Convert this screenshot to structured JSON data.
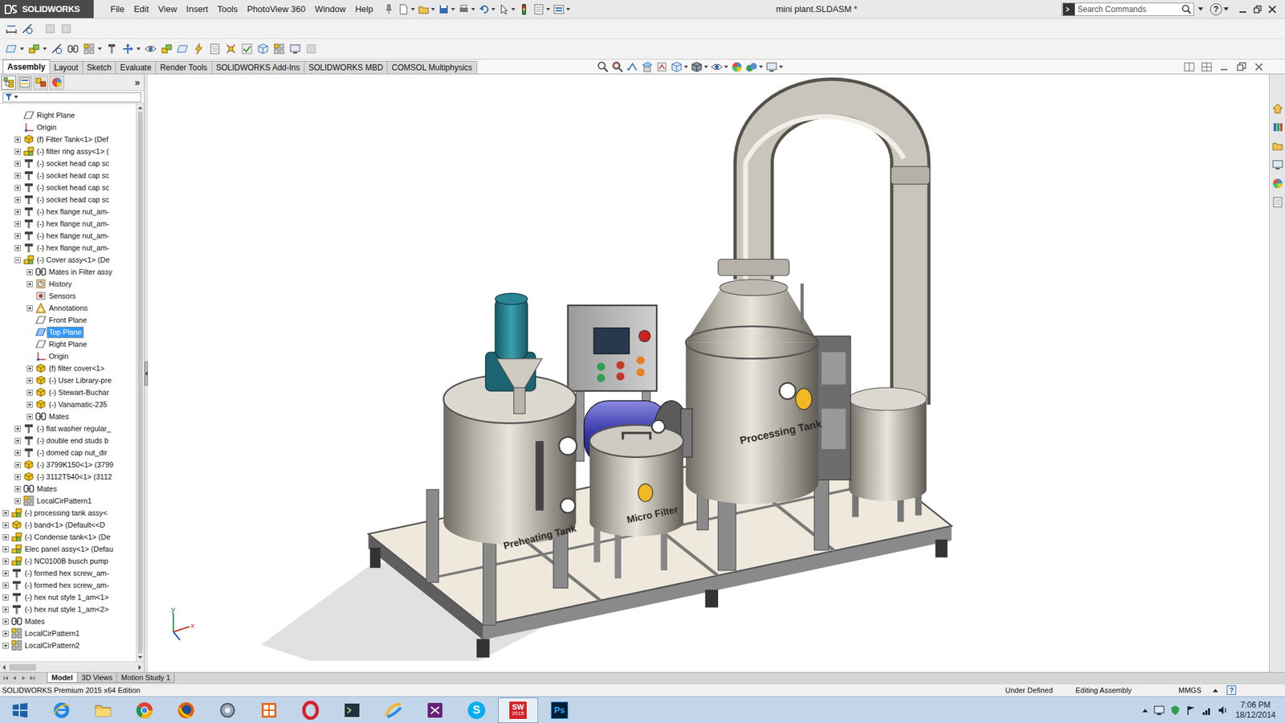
{
  "window": {
    "title": "mini plant.SLDASM *",
    "logo": "SOLIDWORKS",
    "help": "?"
  },
  "menu": [
    "File",
    "Edit",
    "View",
    "Insert",
    "Tools",
    "PhotoView 360",
    "Window",
    "Help"
  ],
  "search": {
    "placeholder": "Search Commands"
  },
  "command_tabs": [
    {
      "label": "Assembly",
      "selected": true
    },
    {
      "label": "Layout",
      "selected": false
    },
    {
      "label": "Sketch",
      "selected": false
    },
    {
      "label": "Evaluate",
      "selected": false
    },
    {
      "label": "Render Tools",
      "selected": false
    },
    {
      "label": "SOLIDWORKS Add-Ins",
      "selected": false
    },
    {
      "label": "SOLIDWORKS MBD",
      "selected": false
    },
    {
      "label": "COMSOL Multiphysics",
      "selected": false
    }
  ],
  "left_panel": {
    "tabs": [
      {
        "kind": "feature",
        "selected": true
      },
      {
        "kind": "property",
        "selected": false
      },
      {
        "kind": "configuration",
        "selected": false
      },
      {
        "kind": "display",
        "selected": false
      }
    ],
    "more": "»"
  },
  "feature_tree": {
    "items": [
      {
        "label": "Right Plane",
        "level": 1,
        "kind": "plane",
        "expandable": false,
        "expanded": false,
        "selected": false
      },
      {
        "label": "Origin",
        "level": 1,
        "kind": "origin",
        "expandable": false,
        "expanded": false,
        "selected": false
      },
      {
        "label": "(f) Filter Tank<1> (Def",
        "level": 1,
        "kind": "part",
        "expandable": true,
        "expanded": false,
        "selected": false
      },
      {
        "label": "(-) filter ring assy<1> (",
        "level": 1,
        "kind": "assembly",
        "expandable": true,
        "expanded": false,
        "selected": false
      },
      {
        "label": "(-) socket head cap sc",
        "level": 1,
        "kind": "hardware",
        "expandable": true,
        "expanded": false,
        "selected": false
      },
      {
        "label": "(-) socket head cap sc",
        "level": 1,
        "kind": "hardware",
        "expandable": true,
        "expanded": false,
        "selected": false
      },
      {
        "label": "(-) socket head cap sc",
        "level": 1,
        "kind": "hardware",
        "expandable": true,
        "expanded": false,
        "selected": false
      },
      {
        "label": "(-) socket head cap sc",
        "level": 1,
        "kind": "hardware",
        "expandable": true,
        "expanded": false,
        "selected": false
      },
      {
        "label": "(-) hex flange nut_am-",
        "level": 1,
        "kind": "hardware",
        "expandable": true,
        "expanded": false,
        "selected": false
      },
      {
        "label": "(-) hex flange nut_am-",
        "level": 1,
        "kind": "hardware",
        "expandable": true,
        "expanded": false,
        "selected": false
      },
      {
        "label": "(-) hex flange nut_am-",
        "level": 1,
        "kind": "hardware",
        "expandable": true,
        "expanded": false,
        "selected": false
      },
      {
        "label": "(-) hex flange nut_am-",
        "level": 1,
        "kind": "hardware",
        "expandable": true,
        "expanded": false,
        "selected": false
      },
      {
        "label": "(-) Cover assy<1> (De",
        "level": 1,
        "kind": "assembly",
        "expandable": true,
        "expanded": true,
        "selected": false
      },
      {
        "label": "Mates in Filter assy",
        "level": 2,
        "kind": "mates",
        "expandable": true,
        "expanded": false,
        "selected": false
      },
      {
        "label": "History",
        "level": 2,
        "kind": "history",
        "expandable": true,
        "expanded": false,
        "selected": false
      },
      {
        "label": "Sensors",
        "level": 2,
        "kind": "sensors",
        "expandable": false,
        "expanded": false,
        "selected": false
      },
      {
        "label": "Annotations",
        "level": 2,
        "kind": "annotations",
        "expandable": true,
        "expanded": false,
        "selected": false
      },
      {
        "label": "Front Plane",
        "level": 2,
        "kind": "plane",
        "expandable": false,
        "expanded": false,
        "selected": false
      },
      {
        "label": "Top Plane",
        "level": 2,
        "kind": "plane",
        "expandable": false,
        "expanded": false,
        "selected": true
      },
      {
        "label": "Right Plane",
        "level": 2,
        "kind": "plane",
        "expandable": false,
        "expanded": false,
        "selected": false
      },
      {
        "label": "Origin",
        "level": 2,
        "kind": "origin",
        "expandable": false,
        "expanded": false,
        "selected": false
      },
      {
        "label": "(f) filter cover<1>",
        "level": 2,
        "kind": "part",
        "expandable": true,
        "expanded": false,
        "selected": false
      },
      {
        "label": "(-) User Library-pre",
        "level": 2,
        "kind": "part",
        "expandable": true,
        "expanded": false,
        "selected": false
      },
      {
        "label": "(-) Stewart-Buchar",
        "level": 2,
        "kind": "part",
        "expandable": true,
        "expanded": false,
        "selected": false
      },
      {
        "label": "(-) Vanamatic-235",
        "level": 2,
        "kind": "part",
        "expandable": true,
        "expanded": false,
        "selected": false
      },
      {
        "label": "Mates",
        "level": 2,
        "kind": "mates",
        "expandable": true,
        "expanded": false,
        "selected": false
      },
      {
        "label": "(-) flat washer regular_",
        "level": 1,
        "kind": "hardware",
        "expandable": true,
        "expanded": false,
        "selected": false
      },
      {
        "label": "(-) double end studs b",
        "level": 1,
        "kind": "hardware",
        "expandable": true,
        "expanded": false,
        "selected": false
      },
      {
        "label": "(-) domed cap nut_dir",
        "level": 1,
        "kind": "hardware",
        "expandable": true,
        "expanded": false,
        "selected": false
      },
      {
        "label": "(-) 3799K150<1> (3799",
        "level": 1,
        "kind": "part",
        "expandable": true,
        "expanded": false,
        "selected": false
      },
      {
        "label": "(-) 3112T540<1> (3112",
        "level": 1,
        "kind": "part",
        "expandable": true,
        "expanded": false,
        "selected": false
      },
      {
        "label": "Mates",
        "level": 1,
        "kind": "mates",
        "expandable": true,
        "expanded": false,
        "selected": false
      },
      {
        "label": "LocalCirPattern1",
        "level": 1,
        "kind": "pattern",
        "expandable": true,
        "expanded": false,
        "selected": false
      },
      {
        "label": "(-) processing tank assy<",
        "level": 0,
        "kind": "assembly",
        "expandable": true,
        "expanded": false,
        "selected": false
      },
      {
        "label": "(-) band<1> (Default<<D",
        "level": 0,
        "kind": "part",
        "expandable": true,
        "expanded": false,
        "selected": false
      },
      {
        "label": "(-) Condense tank<1> (De",
        "level": 0,
        "kind": "assembly",
        "expandable": true,
        "expanded": false,
        "selected": false
      },
      {
        "label": "Elec panel assy<1> (Defau",
        "level": 0,
        "kind": "assembly",
        "expandable": true,
        "expanded": false,
        "selected": false
      },
      {
        "label": "(-) NC0100B busch pump",
        "level": 0,
        "kind": "assembly",
        "expandable": true,
        "expanded": false,
        "selected": false
      },
      {
        "label": "(-) formed hex screw_am-",
        "level": 0,
        "kind": "hardware",
        "expandable": true,
        "expanded": false,
        "selected": false
      },
      {
        "label": "(-) formed hex screw_am-",
        "level": 0,
        "kind": "hardware",
        "expandable": true,
        "expanded": false,
        "selected": false
      },
      {
        "label": "(-) hex nut style 1_am<1>",
        "level": 0,
        "kind": "hardware",
        "expandable": true,
        "expanded": false,
        "selected": false
      },
      {
        "label": "(-) hex nut style 1_am<2>",
        "level": 0,
        "kind": "hardware",
        "expandable": true,
        "expanded": false,
        "selected": false
      },
      {
        "label": "Mates",
        "level": 0,
        "kind": "mates",
        "expandable": true,
        "expanded": false,
        "selected": false
      },
      {
        "label": "LocalCirPattern1",
        "level": 0,
        "kind": "pattern",
        "expandable": true,
        "expanded": false,
        "selected": false
      },
      {
        "label": "LocalCirPattern2",
        "level": 0,
        "kind": "pattern",
        "expandable": true,
        "expanded": false,
        "selected": false
      }
    ]
  },
  "viewport": {
    "triad": [
      "y",
      "x"
    ],
    "labels": [
      "Preheating Tank",
      "Micro Filter",
      "Processing Tank"
    ]
  },
  "bottom_tabs": [
    {
      "label": "Model",
      "selected": true
    },
    {
      "label": "3D Views",
      "selected": false
    },
    {
      "label": "Motion Study 1",
      "selected": false
    }
  ],
  "status_bar": {
    "product": "SOLIDWORKS Premium 2015 x64 Edition",
    "state": "Under Defined",
    "mode": "Editing Assembly",
    "units": "MMGS",
    "help": "?"
  },
  "taskbar": {
    "apps": [
      {
        "kind": "start",
        "selected": false
      },
      {
        "kind": "ie",
        "selected": false
      },
      {
        "kind": "explorer",
        "selected": false
      },
      {
        "kind": "chrome",
        "selected": false
      },
      {
        "kind": "firefox",
        "selected": false
      },
      {
        "kind": "tool",
        "selected": false
      },
      {
        "kind": "apps",
        "selected": false
      },
      {
        "kind": "opera",
        "selected": false
      },
      {
        "kind": "terminal",
        "selected": false
      },
      {
        "kind": "photos",
        "selected": false
      },
      {
        "kind": "studio",
        "selected": false
      },
      {
        "kind": "skype",
        "text": "S",
        "selected": false
      },
      {
        "kind": "solidworks",
        "text": "SW",
        "subtext": "2015",
        "selected": true
      },
      {
        "kind": "photoshop",
        "text": "Ps",
        "selected": false
      }
    ],
    "time": "7:06 PM",
    "date": "18/12/2014"
  }
}
